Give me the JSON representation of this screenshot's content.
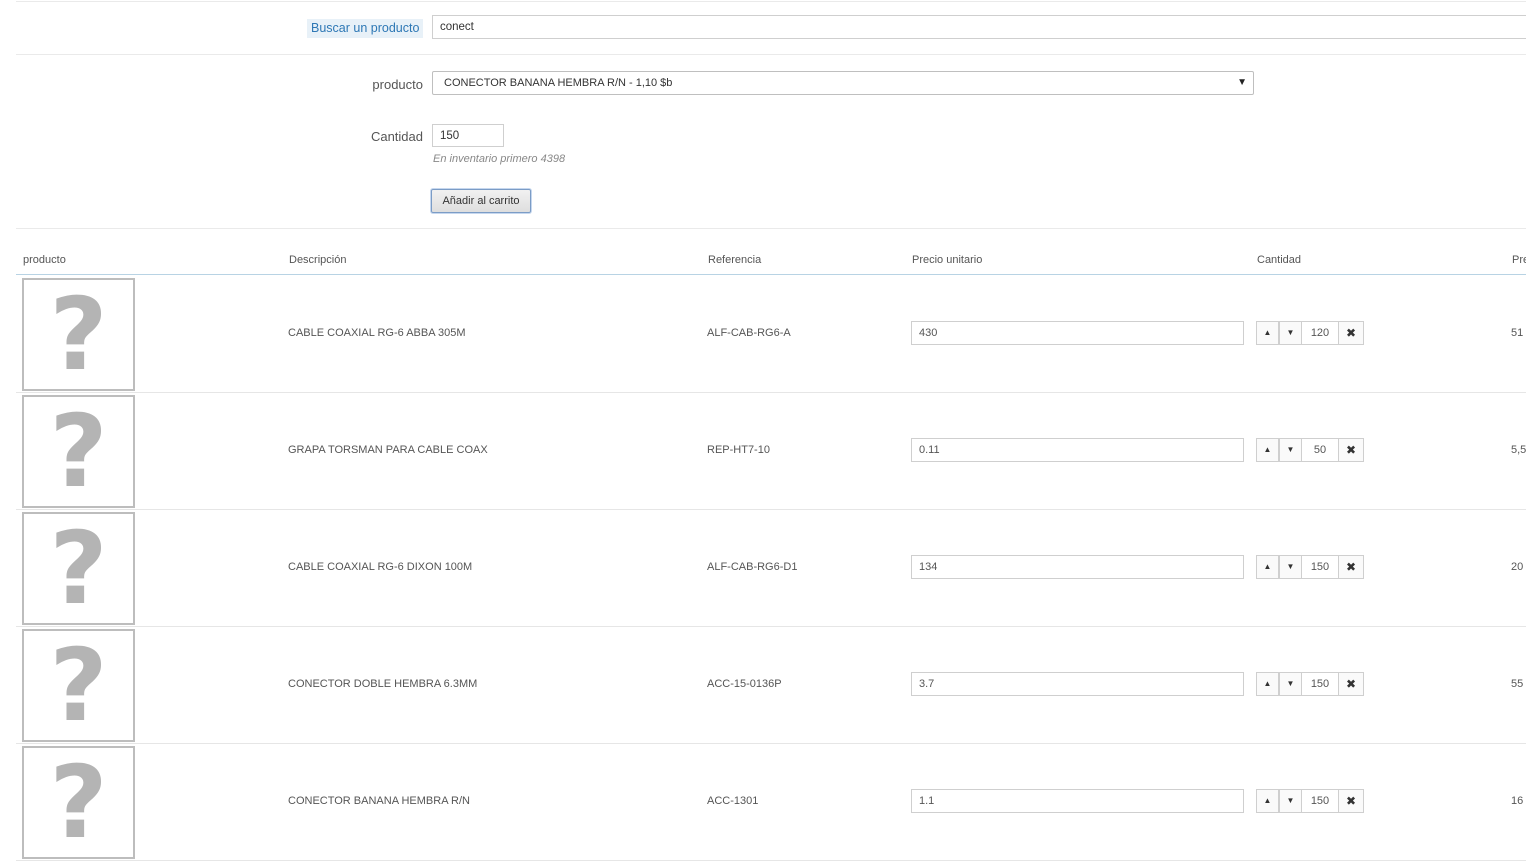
{
  "search": {
    "label": "Buscar un producto",
    "value": "conect"
  },
  "form": {
    "product_label": "producto",
    "product_selected": "CONECTOR BANANA HEMBRA R/N - 1,10 $b",
    "qty_label": "Cantidad",
    "qty_value": "150",
    "stock_hint": "En inventario primero 4398",
    "add_button": "Añadir al carrito"
  },
  "table": {
    "headers": [
      "producto",
      "Descripción",
      "Referencia",
      "Precio unitario",
      "Cantidad",
      "Pre"
    ],
    "rows": [
      {
        "description": "CABLE COAXIAL RG-6 ABBA 305M",
        "reference": "ALF-CAB-RG6-A",
        "price": "430",
        "qty": "120",
        "total": "51"
      },
      {
        "description": "GRAPA TORSMAN PARA CABLE COAX",
        "reference": "REP-HT7-10",
        "price": "0.11",
        "qty": "50",
        "total": "5,5"
      },
      {
        "description": "CABLE COAXIAL RG-6 DIXON 100M",
        "reference": "ALF-CAB-RG6-D1",
        "price": "134",
        "qty": "150",
        "total": "20"
      },
      {
        "description": "CONECTOR DOBLE HEMBRA 6.3MM",
        "reference": "ACC-15-0136P",
        "price": "3.7",
        "qty": "150",
        "total": "55"
      },
      {
        "description": "CONECTOR BANANA HEMBRA R/N",
        "reference": "ACC-1301",
        "price": "1.1",
        "qty": "150",
        "total": "16"
      }
    ]
  },
  "icons": {
    "placeholder": "question-mark",
    "up": "triangle-up",
    "down": "triangle-down",
    "remove": "x"
  }
}
